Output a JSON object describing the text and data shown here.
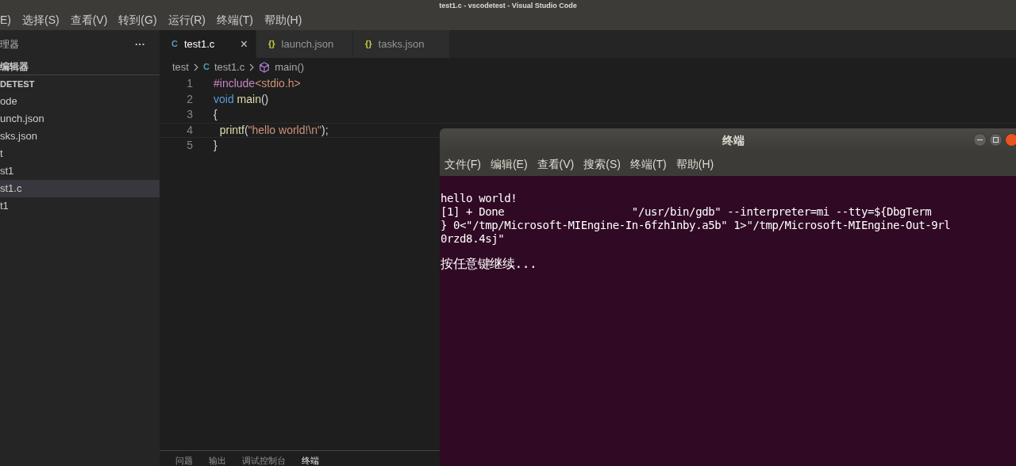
{
  "window": {
    "title": "test1.c - vscodetest - Visual Studio Code"
  },
  "menu": [
    "E)",
    "选择(S)",
    "查看(V)",
    "转到(G)",
    "运行(R)",
    "终端(T)",
    "帮助(H)"
  ],
  "sidebar": {
    "title": "理器",
    "more": "···",
    "section": "编辑器",
    "folder": "DETEST",
    "items": [
      {
        "label": "ode",
        "selected": false
      },
      {
        "label": "unch.json",
        "selected": false
      },
      {
        "label": "sks.json",
        "selected": false
      },
      {
        "label": "t",
        "selected": false
      },
      {
        "label": "st1",
        "selected": false
      },
      {
        "label": "st1.c",
        "selected": true
      },
      {
        "label": "t1",
        "selected": false
      }
    ]
  },
  "tabs": [
    {
      "icon": "C",
      "kind": "c",
      "label": "test1.c",
      "selected": true,
      "close": "×"
    },
    {
      "icon": "{}",
      "kind": "json",
      "label": "launch.json",
      "selected": false
    },
    {
      "icon": "{}",
      "kind": "json",
      "label": "tasks.json",
      "selected": false
    }
  ],
  "breadcrumb": [
    {
      "kind": "folder",
      "label": "test"
    },
    {
      "kind": "c",
      "icon": "C",
      "label": "test1.c"
    },
    {
      "kind": "symbol",
      "label": "main()"
    }
  ],
  "code": [
    {
      "number": "1",
      "tokens": [
        {
          "kind": "keyword",
          "text": "#include"
        },
        {
          "kind": "string",
          "text": "<stdio.h>"
        }
      ]
    },
    {
      "number": "2",
      "tokens": [
        {
          "kind": "type",
          "text": "void"
        },
        {
          "kind": "function",
          "text": " main"
        },
        {
          "kind": "plain",
          "text": "()"
        }
      ]
    },
    {
      "number": "3",
      "tokens": [
        {
          "kind": "plain",
          "text": "{"
        }
      ]
    },
    {
      "number": "4",
      "tokens": [
        {
          "kind": "function",
          "text": "  printf"
        },
        {
          "kind": "plain",
          "text": "("
        },
        {
          "kind": "string",
          "text": "\"hello world!\\n\""
        },
        {
          "kind": "plain",
          "text": ");"
        }
      ]
    },
    {
      "number": "5",
      "tokens": [
        {
          "kind": "plain",
          "text": "}"
        }
      ]
    }
  ],
  "panel_tabs": [
    {
      "label": "问题",
      "selected": false
    },
    {
      "label": "输出",
      "selected": false
    },
    {
      "label": "调试控制台",
      "selected": false
    },
    {
      "label": "终端",
      "selected": true
    }
  ],
  "terminal": {
    "title": "终端",
    "menu": [
      "文件(F)",
      "编辑(E)",
      "查看(V)",
      "搜索(S)",
      "终端(T)",
      "帮助(H)"
    ],
    "lines": [
      {
        "text": "hello world!",
        "gap_before": false
      },
      {
        "text": "[1] + Done                    \"/usr/bin/gdb\" --interpreter=mi --tty=${DbgTerm",
        "gap_before": false
      },
      {
        "text": "} 0<\"/tmp/Microsoft-MIEngine-In-6fzh1nby.a5b\" 1>\"/tmp/Microsoft-MIEngine-Out-9rl",
        "gap_before": false
      },
      {
        "text": "0rzd8.4sj\"",
        "gap_before": false
      },
      {
        "text": "按任意键继续...",
        "gap_before": true
      }
    ]
  }
}
